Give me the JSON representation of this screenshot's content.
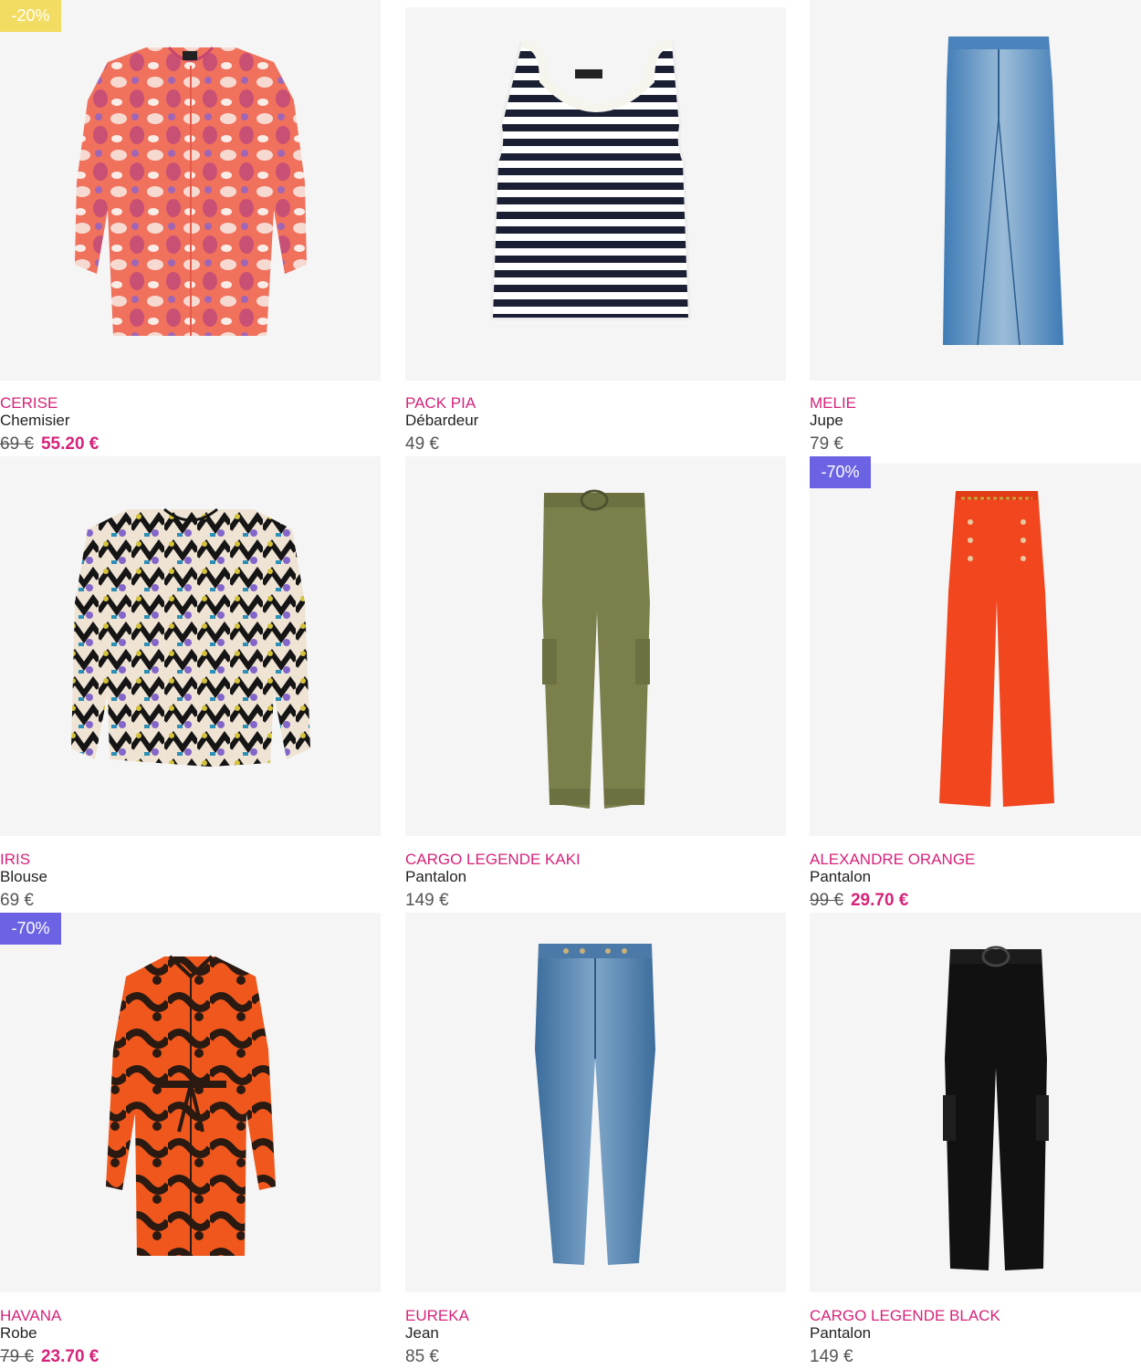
{
  "colors": {
    "brand_pink": "#d6237a",
    "badge_yellow": "#f3dc62",
    "badge_purple": "#6b63e3",
    "image_bg": "#f5f5f5",
    "text_dark": "#222222",
    "text_price": "#555555"
  },
  "products": [
    {
      "name": "CERISE",
      "category": "Chemisier",
      "old_price": "69 €",
      "price": "55.20 €",
      "badge": "-20%",
      "badge_color": "yellow",
      "icon": "floral-blouse-icon"
    },
    {
      "name": "PACK PIA",
      "category": "Débardeur",
      "old_price": "",
      "price": "49 €",
      "badge": "",
      "icon": "striped-tank-top-icon"
    },
    {
      "name": "MELIE",
      "category": "Jupe",
      "old_price": "",
      "price": "79 €",
      "badge": "",
      "icon": "denim-skirt-icon"
    },
    {
      "name": "IRIS",
      "category": "Blouse",
      "old_price": "",
      "price": "69 €",
      "badge": "",
      "icon": "printed-blouse-icon"
    },
    {
      "name": "CARGO LEGENDE KAKI",
      "category": "Pantalon",
      "old_price": "",
      "price": "149 €",
      "badge": "",
      "icon": "khaki-cargo-pants-icon"
    },
    {
      "name": "ALEXANDRE ORANGE",
      "category": "Pantalon",
      "old_price": "99 €",
      "price": "29.70 €",
      "badge": "-70%",
      "badge_color": "purple",
      "icon": "orange-wide-pants-icon"
    },
    {
      "name": "HAVANA",
      "category": "Robe",
      "old_price": "79 €",
      "price": "23.70 €",
      "badge": "-70%",
      "badge_color": "purple",
      "icon": "shirt-dress-icon"
    },
    {
      "name": "EUREKA",
      "category": "Jean",
      "old_price": "",
      "price": "85 €",
      "badge": "",
      "icon": "jeans-icon"
    },
    {
      "name": "CARGO LEGENDE BLACK",
      "category": "Pantalon",
      "old_price": "",
      "price": "149 €",
      "badge": "",
      "icon": "black-cargo-pants-icon"
    }
  ]
}
